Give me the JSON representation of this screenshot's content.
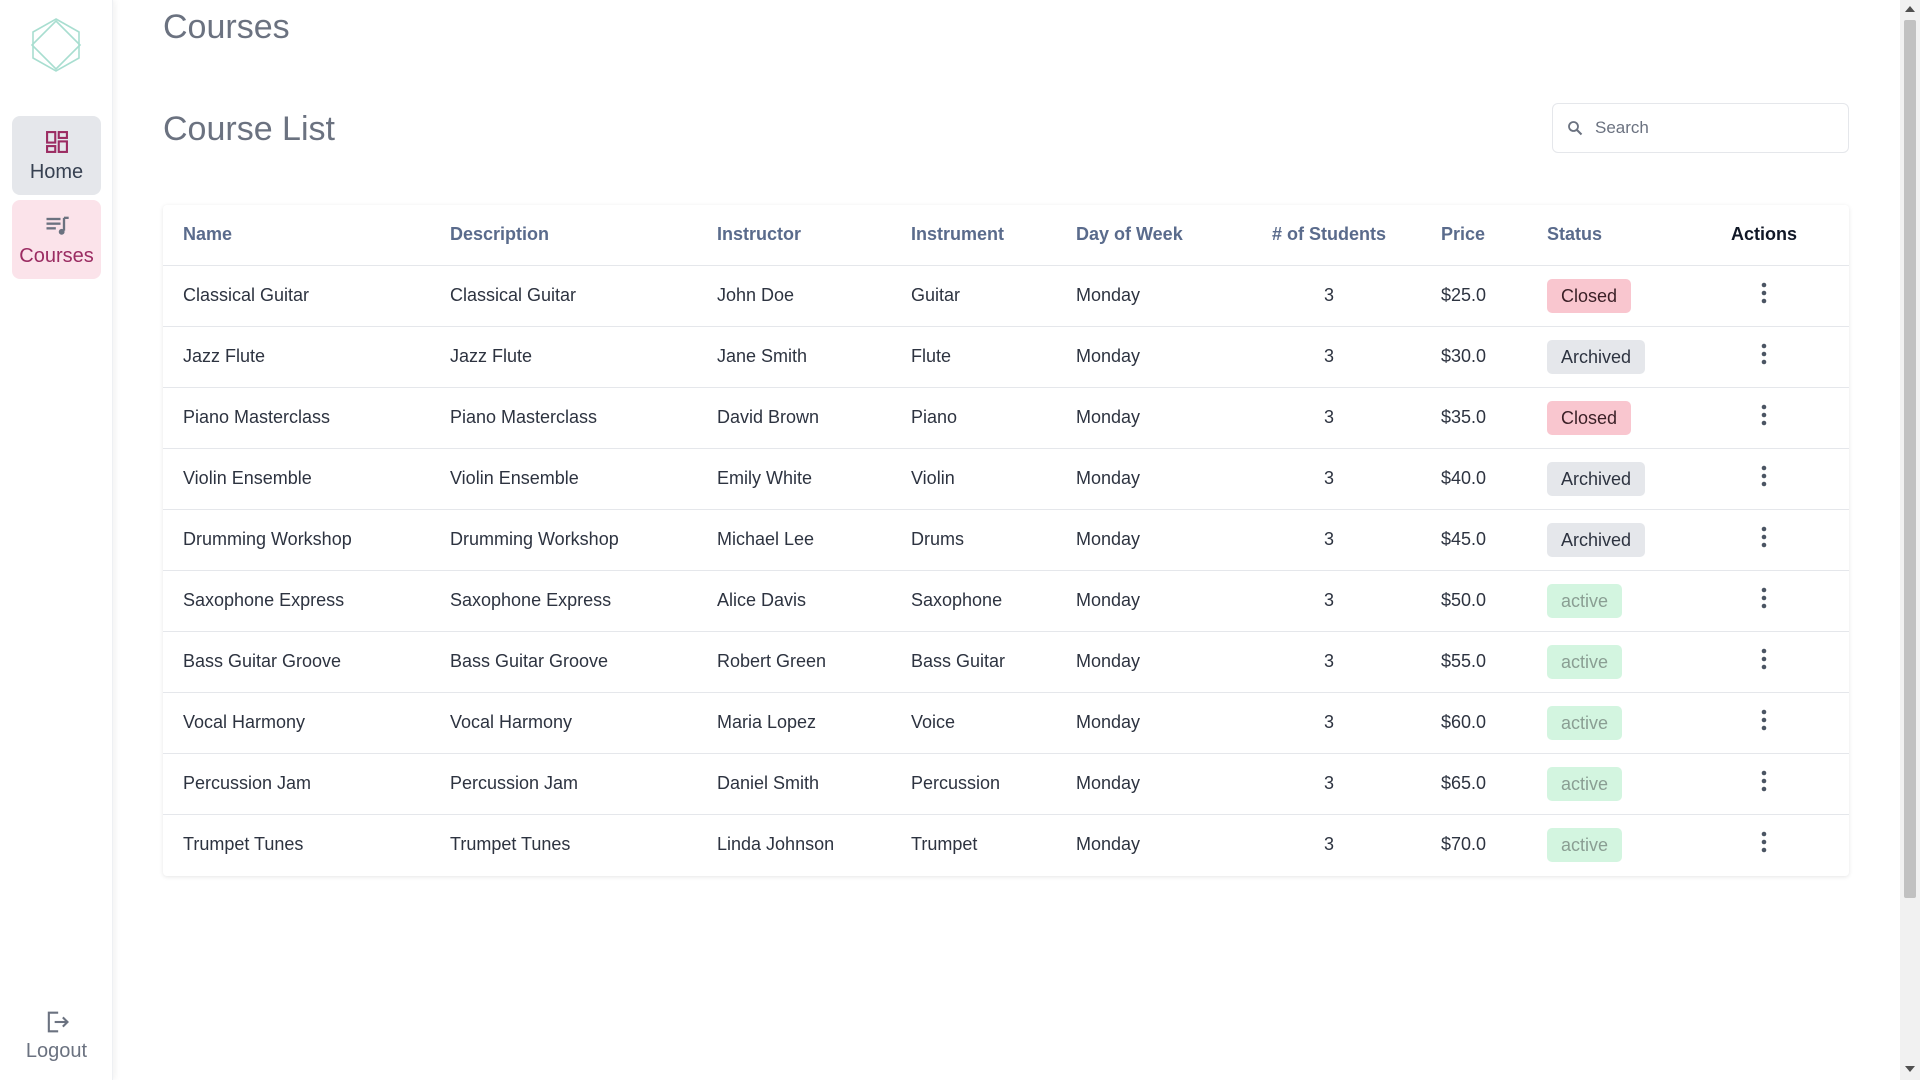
{
  "sidebar": {
    "home_label": "Home",
    "courses_label": "Courses",
    "logout_label": "Logout"
  },
  "header": {
    "page_title": "Courses",
    "section_title": "Course List"
  },
  "search": {
    "placeholder": "Search",
    "value": ""
  },
  "table": {
    "columns": [
      "Name",
      "Description",
      "Instructor",
      "Instrument",
      "Day of Week",
      "# of Students",
      "Price",
      "Status",
      "Actions"
    ],
    "rows": [
      {
        "name": "Classical Guitar",
        "description": "Classical Guitar",
        "instructor": "John Doe",
        "instrument": "Guitar",
        "day": "Monday",
        "students": "3",
        "price": "$25.0",
        "status": "Closed"
      },
      {
        "name": "Jazz Flute",
        "description": "Jazz Flute",
        "instructor": "Jane Smith",
        "instrument": "Flute",
        "day": "Monday",
        "students": "3",
        "price": "$30.0",
        "status": "Archived"
      },
      {
        "name": "Piano Masterclass",
        "description": "Piano Masterclass",
        "instructor": "David Brown",
        "instrument": "Piano",
        "day": "Monday",
        "students": "3",
        "price": "$35.0",
        "status": "Closed"
      },
      {
        "name": "Violin Ensemble",
        "description": "Violin Ensemble",
        "instructor": "Emily White",
        "instrument": "Violin",
        "day": "Monday",
        "students": "3",
        "price": "$40.0",
        "status": "Archived"
      },
      {
        "name": "Drumming Workshop",
        "description": "Drumming Workshop",
        "instructor": "Michael Lee",
        "instrument": "Drums",
        "day": "Monday",
        "students": "3",
        "price": "$45.0",
        "status": "Archived"
      },
      {
        "name": "Saxophone Express",
        "description": "Saxophone Express",
        "instructor": "Alice Davis",
        "instrument": "Saxophone",
        "day": "Monday",
        "students": "3",
        "price": "$50.0",
        "status": "active"
      },
      {
        "name": "Bass Guitar Groove",
        "description": "Bass Guitar Groove",
        "instructor": "Robert Green",
        "instrument": "Bass Guitar",
        "day": "Monday",
        "students": "3",
        "price": "$55.0",
        "status": "active"
      },
      {
        "name": "Vocal Harmony",
        "description": "Vocal Harmony",
        "instructor": "Maria Lopez",
        "instrument": "Voice",
        "day": "Monday",
        "students": "3",
        "price": "$60.0",
        "status": "active"
      },
      {
        "name": "Percussion Jam",
        "description": "Percussion Jam",
        "instructor": "Daniel Smith",
        "instrument": "Percussion",
        "day": "Monday",
        "students": "3",
        "price": "$65.0",
        "status": "active"
      },
      {
        "name": "Trumpet Tunes",
        "description": "Trumpet Tunes",
        "instructor": "Linda Johnson",
        "instrument": "Trumpet",
        "day": "Monday",
        "students": "3",
        "price": "$70.0",
        "status": "active"
      }
    ]
  },
  "icons": {
    "logo": "hexagon-logo-icon",
    "home": "dashboard-icon",
    "courses": "playlist-music-icon",
    "logout": "logout-icon",
    "search": "search-icon",
    "row_actions": "more-vertical-icon"
  },
  "colors": {
    "closed_badge": "#f9c6cf",
    "archived_badge": "#e5e7eb",
    "active_badge": "#d3f5e0",
    "courses_nav_bg": "#fbe3ea",
    "courses_nav_text": "#9b2c62",
    "logo": "#a8ded0"
  }
}
